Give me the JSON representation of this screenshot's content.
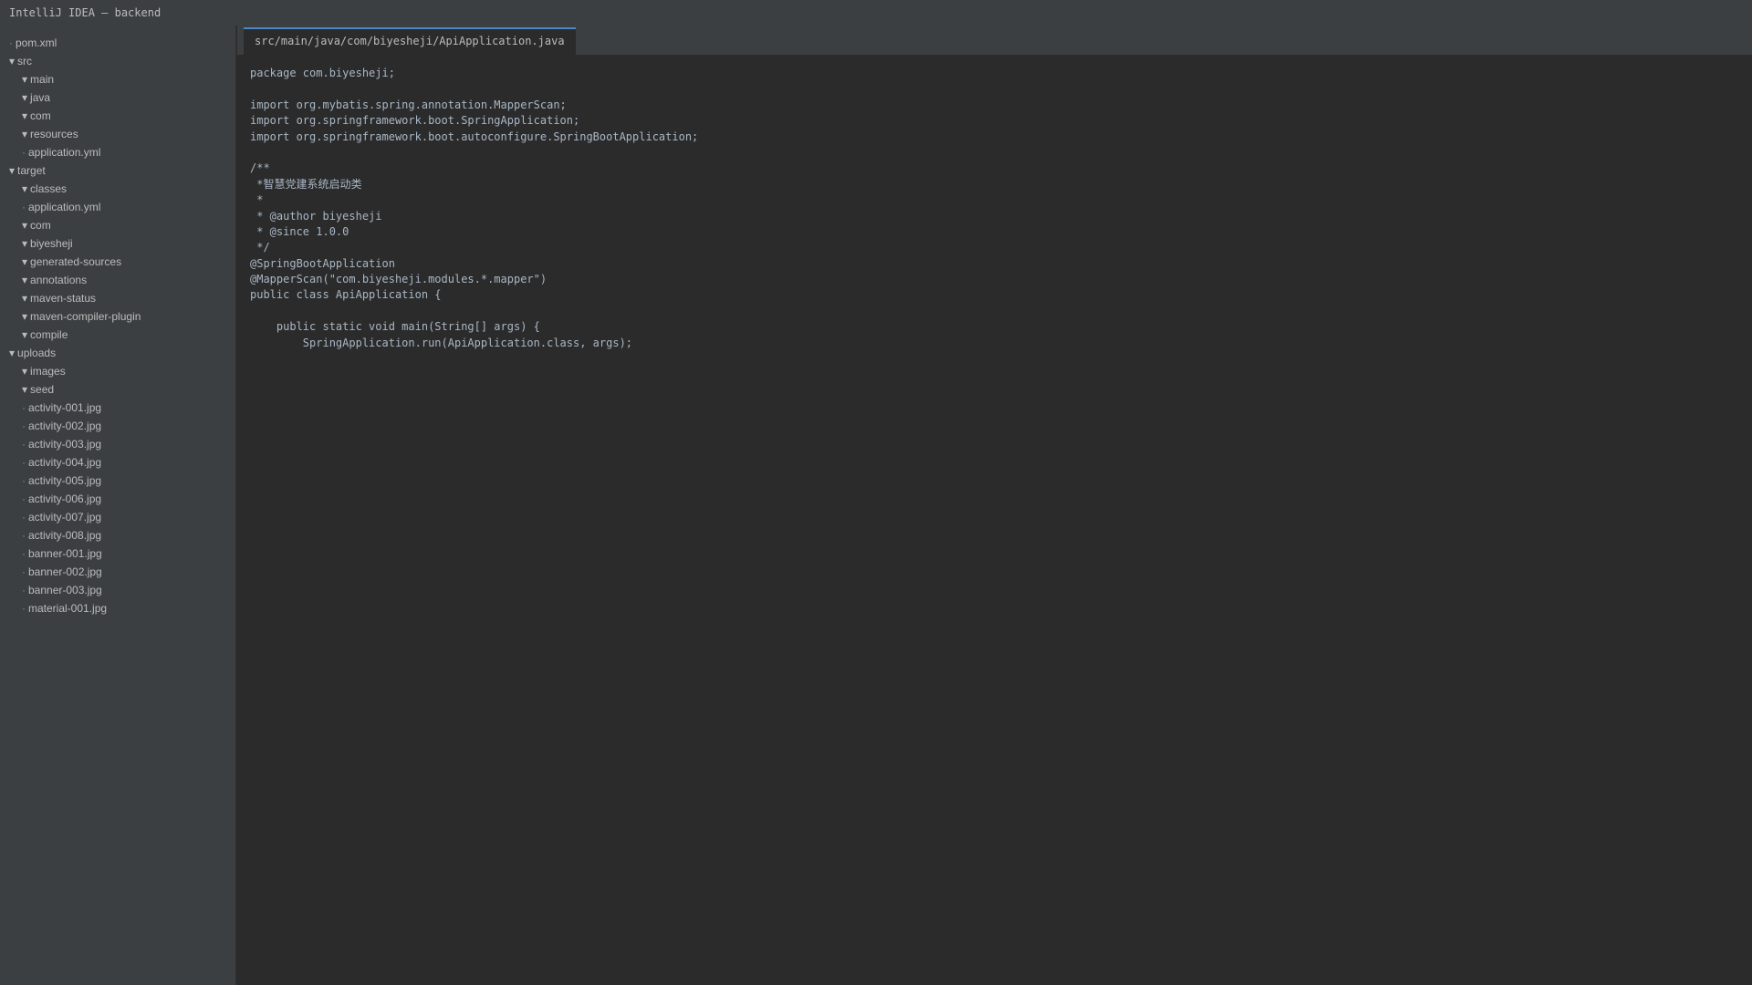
{
  "window": {
    "title": "IntelliJ IDEA — backend"
  },
  "tree": [
    {
      "label": "pom.xml",
      "marker": "·",
      "kind": "file",
      "depth": 0
    },
    {
      "label": "src",
      "marker": "▾",
      "kind": "folder",
      "depth": 0
    },
    {
      "label": "main",
      "marker": "▾",
      "kind": "folder",
      "depth": 1
    },
    {
      "label": "java",
      "marker": "▾",
      "kind": "folder",
      "depth": 1
    },
    {
      "label": "com",
      "marker": "▾",
      "kind": "folder",
      "depth": 1
    },
    {
      "label": "resources",
      "marker": "▾",
      "kind": "folder",
      "depth": 1
    },
    {
      "label": "application.yml",
      "marker": "·",
      "kind": "file",
      "depth": 1
    },
    {
      "label": "target",
      "marker": "▾",
      "kind": "folder",
      "depth": 0
    },
    {
      "label": "classes",
      "marker": "▾",
      "kind": "folder",
      "depth": 1
    },
    {
      "label": "application.yml",
      "marker": "·",
      "kind": "file",
      "depth": 1
    },
    {
      "label": "com",
      "marker": "▾",
      "kind": "folder",
      "depth": 1
    },
    {
      "label": "biyesheji",
      "marker": "▾",
      "kind": "folder",
      "depth": 1
    },
    {
      "label": "generated-sources",
      "marker": "▾",
      "kind": "folder",
      "depth": 1
    },
    {
      "label": "annotations",
      "marker": "▾",
      "kind": "folder",
      "depth": 1
    },
    {
      "label": "maven-status",
      "marker": "▾",
      "kind": "folder",
      "depth": 1
    },
    {
      "label": "maven-compiler-plugin",
      "marker": "▾",
      "kind": "folder",
      "depth": 1
    },
    {
      "label": "compile",
      "marker": "▾",
      "kind": "folder",
      "depth": 1
    },
    {
      "label": "uploads",
      "marker": "▾",
      "kind": "folder",
      "depth": 0
    },
    {
      "label": "images",
      "marker": "▾",
      "kind": "folder",
      "depth": 1
    },
    {
      "label": "seed",
      "marker": "▾",
      "kind": "folder",
      "depth": 1
    },
    {
      "label": "activity-001.jpg",
      "marker": "·",
      "kind": "file",
      "depth": 1
    },
    {
      "label": "activity-002.jpg",
      "marker": "·",
      "kind": "file",
      "depth": 1
    },
    {
      "label": "activity-003.jpg",
      "marker": "·",
      "kind": "file",
      "depth": 1
    },
    {
      "label": "activity-004.jpg",
      "marker": "·",
      "kind": "file",
      "depth": 1
    },
    {
      "label": "activity-005.jpg",
      "marker": "·",
      "kind": "file",
      "depth": 1
    },
    {
      "label": "activity-006.jpg",
      "marker": "·",
      "kind": "file",
      "depth": 1
    },
    {
      "label": "activity-007.jpg",
      "marker": "·",
      "kind": "file",
      "depth": 1
    },
    {
      "label": "activity-008.jpg",
      "marker": "·",
      "kind": "file",
      "depth": 1
    },
    {
      "label": "banner-001.jpg",
      "marker": "·",
      "kind": "file",
      "depth": 1
    },
    {
      "label": "banner-002.jpg",
      "marker": "·",
      "kind": "file",
      "depth": 1
    },
    {
      "label": "banner-003.jpg",
      "marker": "·",
      "kind": "file",
      "depth": 1
    },
    {
      "label": "material-001.jpg",
      "marker": "·",
      "kind": "file",
      "depth": 1
    }
  ],
  "editor": {
    "tab_label": "src/main/java/com/biyesheji/ApiApplication.java",
    "lines": [
      "package com.biyesheji;",
      "",
      "import org.mybatis.spring.annotation.MapperScan;",
      "import org.springframework.boot.SpringApplication;",
      "import org.springframework.boot.autoconfigure.SpringBootApplication;",
      "",
      "/**",
      " *智慧党建系统启动类",
      " *",
      " * @author biyesheji",
      " * @since 1.0.0",
      " */",
      "@SpringBootApplication",
      "@MapperScan(\"com.biyesheji.modules.*.mapper\")",
      "public class ApiApplication {",
      "",
      "    public static void main(String[] args) {",
      "        SpringApplication.run(ApiApplication.class, args);"
    ]
  },
  "colors": {
    "background": "#2b2b2b",
    "panel": "#3c3f41",
    "text": "#bbbbbb",
    "code_text": "#a9b7c6",
    "tab_accent": "#4a88c7"
  }
}
